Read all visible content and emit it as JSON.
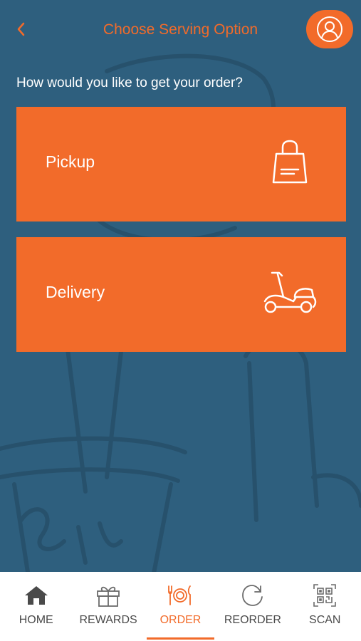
{
  "header": {
    "title": "Choose Serving Option",
    "back_icon": "chevron-left-icon",
    "profile_icon": "user-profile-icon"
  },
  "question": "How would you like to get your order?",
  "options": [
    {
      "label": "Pickup",
      "icon": "shopping-bag-icon"
    },
    {
      "label": "Delivery",
      "icon": "scooter-icon"
    }
  ],
  "tabbar": {
    "active": "ORDER",
    "items": [
      {
        "label": "HOME",
        "icon": "home-icon"
      },
      {
        "label": "REWARDS",
        "icon": "gift-icon"
      },
      {
        "label": "ORDER",
        "icon": "dining-icon"
      },
      {
        "label": "REORDER",
        "icon": "refresh-icon"
      },
      {
        "label": "SCAN",
        "icon": "qr-code-icon"
      }
    ]
  },
  "colors": {
    "background": "#2e5f7e",
    "accent": "#f26b2a",
    "tabbar": "#ffffff",
    "tab_text": "#4a4a4a"
  }
}
